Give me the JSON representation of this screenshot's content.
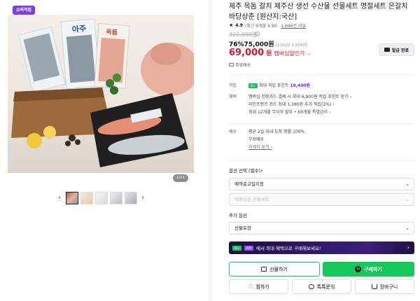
{
  "gallery": {
    "badge": "슈퍼적립",
    "counter": "1/11",
    "prev": "‹",
    "next": "›",
    "thumbnails": 5
  },
  "product": {
    "title": "제주 옥돔 갈치 제주산 생선 수산물 선물세트 명절세트 은갈치 바당상춘 [원산지:국산]",
    "rating": "4.9",
    "rating_note": "(최근 6개월 4.90",
    "reviews": "1,646건 리뷰",
    "original_price": "322,000원",
    "discount": "76%75,000원",
    "unit_price": "(100g당 4,839원)",
    "sale_price": "69,000",
    "sale_won": "원",
    "member_discount": "멤버십할인가 ⌵",
    "coupon_button": "발급 완료",
    "free_shipping": "무료배송"
  },
  "benefits": {
    "point_label": "적립",
    "point_text": "최대 적립 포인트",
    "point_value": "18,400원",
    "benefit_label": "혜택",
    "benefit_lines": [
      "멤버십 전용카드 결제 시 최대 6,900원 적립 포인트 받기 ›",
      "라인프렌즈 카드 최대 1,380원 추가 적립(2%) ›",
      "최대 12개월 무이자 할부 • 60개월 특별금리 ›"
    ],
    "delivery_label": "배송",
    "delivery_lines": [
      "평균 2일 이내 도착 확률 100%",
      "무료배송"
    ],
    "delivery_link": "자세히 보기 ›"
  },
  "options": {
    "select_label": "옵션 선택 (필수)",
    "required_mark": "•",
    "select1": "예약출고일지정",
    "select2": "택배상춘 선물세트",
    "extra_label": "추가 옵션",
    "extra_select": "선물포장"
  },
  "promo": {
    "text": "에서 최대 혜택으로 구매해보세요!",
    "app_chip": "APP"
  },
  "actions": {
    "gift": "선물하기",
    "buy": "구매하기",
    "wish": "찜하기",
    "talk": "톡톡문의",
    "cart": "장바구니"
  },
  "colors": {
    "brand_green": "#14c85c",
    "sale_red": "#e8112d",
    "super_purple": "#7b3fe4"
  }
}
